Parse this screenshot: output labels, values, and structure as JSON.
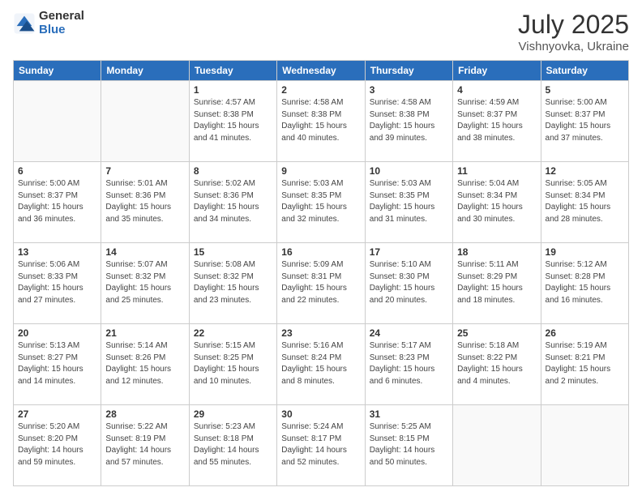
{
  "header": {
    "logo_general": "General",
    "logo_blue": "Blue",
    "month": "July 2025",
    "location": "Vishnyovka, Ukraine"
  },
  "weekdays": [
    "Sunday",
    "Monday",
    "Tuesday",
    "Wednesday",
    "Thursday",
    "Friday",
    "Saturday"
  ],
  "weeks": [
    [
      {
        "day": "",
        "info": ""
      },
      {
        "day": "",
        "info": ""
      },
      {
        "day": "1",
        "info": "Sunrise: 4:57 AM\nSunset: 8:38 PM\nDaylight: 15 hours and 41 minutes."
      },
      {
        "day": "2",
        "info": "Sunrise: 4:58 AM\nSunset: 8:38 PM\nDaylight: 15 hours and 40 minutes."
      },
      {
        "day": "3",
        "info": "Sunrise: 4:58 AM\nSunset: 8:38 PM\nDaylight: 15 hours and 39 minutes."
      },
      {
        "day": "4",
        "info": "Sunrise: 4:59 AM\nSunset: 8:37 PM\nDaylight: 15 hours and 38 minutes."
      },
      {
        "day": "5",
        "info": "Sunrise: 5:00 AM\nSunset: 8:37 PM\nDaylight: 15 hours and 37 minutes."
      }
    ],
    [
      {
        "day": "6",
        "info": "Sunrise: 5:00 AM\nSunset: 8:37 PM\nDaylight: 15 hours and 36 minutes."
      },
      {
        "day": "7",
        "info": "Sunrise: 5:01 AM\nSunset: 8:36 PM\nDaylight: 15 hours and 35 minutes."
      },
      {
        "day": "8",
        "info": "Sunrise: 5:02 AM\nSunset: 8:36 PM\nDaylight: 15 hours and 34 minutes."
      },
      {
        "day": "9",
        "info": "Sunrise: 5:03 AM\nSunset: 8:35 PM\nDaylight: 15 hours and 32 minutes."
      },
      {
        "day": "10",
        "info": "Sunrise: 5:03 AM\nSunset: 8:35 PM\nDaylight: 15 hours and 31 minutes."
      },
      {
        "day": "11",
        "info": "Sunrise: 5:04 AM\nSunset: 8:34 PM\nDaylight: 15 hours and 30 minutes."
      },
      {
        "day": "12",
        "info": "Sunrise: 5:05 AM\nSunset: 8:34 PM\nDaylight: 15 hours and 28 minutes."
      }
    ],
    [
      {
        "day": "13",
        "info": "Sunrise: 5:06 AM\nSunset: 8:33 PM\nDaylight: 15 hours and 27 minutes."
      },
      {
        "day": "14",
        "info": "Sunrise: 5:07 AM\nSunset: 8:32 PM\nDaylight: 15 hours and 25 minutes."
      },
      {
        "day": "15",
        "info": "Sunrise: 5:08 AM\nSunset: 8:32 PM\nDaylight: 15 hours and 23 minutes."
      },
      {
        "day": "16",
        "info": "Sunrise: 5:09 AM\nSunset: 8:31 PM\nDaylight: 15 hours and 22 minutes."
      },
      {
        "day": "17",
        "info": "Sunrise: 5:10 AM\nSunset: 8:30 PM\nDaylight: 15 hours and 20 minutes."
      },
      {
        "day": "18",
        "info": "Sunrise: 5:11 AM\nSunset: 8:29 PM\nDaylight: 15 hours and 18 minutes."
      },
      {
        "day": "19",
        "info": "Sunrise: 5:12 AM\nSunset: 8:28 PM\nDaylight: 15 hours and 16 minutes."
      }
    ],
    [
      {
        "day": "20",
        "info": "Sunrise: 5:13 AM\nSunset: 8:27 PM\nDaylight: 15 hours and 14 minutes."
      },
      {
        "day": "21",
        "info": "Sunrise: 5:14 AM\nSunset: 8:26 PM\nDaylight: 15 hours and 12 minutes."
      },
      {
        "day": "22",
        "info": "Sunrise: 5:15 AM\nSunset: 8:25 PM\nDaylight: 15 hours and 10 minutes."
      },
      {
        "day": "23",
        "info": "Sunrise: 5:16 AM\nSunset: 8:24 PM\nDaylight: 15 hours and 8 minutes."
      },
      {
        "day": "24",
        "info": "Sunrise: 5:17 AM\nSunset: 8:23 PM\nDaylight: 15 hours and 6 minutes."
      },
      {
        "day": "25",
        "info": "Sunrise: 5:18 AM\nSunset: 8:22 PM\nDaylight: 15 hours and 4 minutes."
      },
      {
        "day": "26",
        "info": "Sunrise: 5:19 AM\nSunset: 8:21 PM\nDaylight: 15 hours and 2 minutes."
      }
    ],
    [
      {
        "day": "27",
        "info": "Sunrise: 5:20 AM\nSunset: 8:20 PM\nDaylight: 14 hours and 59 minutes."
      },
      {
        "day": "28",
        "info": "Sunrise: 5:22 AM\nSunset: 8:19 PM\nDaylight: 14 hours and 57 minutes."
      },
      {
        "day": "29",
        "info": "Sunrise: 5:23 AM\nSunset: 8:18 PM\nDaylight: 14 hours and 55 minutes."
      },
      {
        "day": "30",
        "info": "Sunrise: 5:24 AM\nSunset: 8:17 PM\nDaylight: 14 hours and 52 minutes."
      },
      {
        "day": "31",
        "info": "Sunrise: 5:25 AM\nSunset: 8:15 PM\nDaylight: 14 hours and 50 minutes."
      },
      {
        "day": "",
        "info": ""
      },
      {
        "day": "",
        "info": ""
      }
    ]
  ]
}
